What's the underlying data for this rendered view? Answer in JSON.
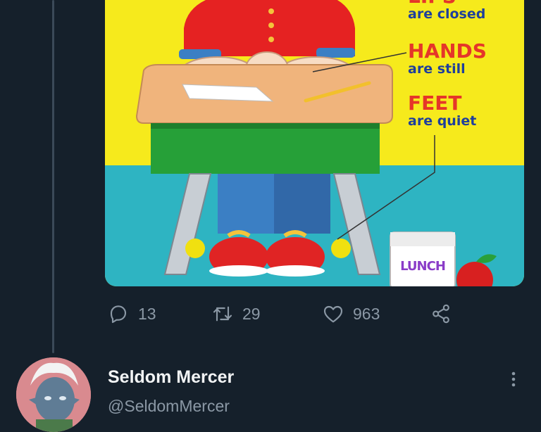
{
  "tweet": {
    "media": {
      "poster_lines": [
        {
          "title": "LIPS",
          "sub": "are closed"
        },
        {
          "title": "HANDS",
          "sub": "are still"
        },
        {
          "title": "FEET",
          "sub": "are quiet"
        }
      ],
      "bag_label": "LUNCH"
    },
    "actions": {
      "reply_count": "13",
      "retweet_count": "29",
      "like_count": "963"
    },
    "icons": [
      "reply-icon",
      "retweet-icon",
      "like-icon",
      "share-icon",
      "more-icon"
    ]
  },
  "reply": {
    "display_name": "Seldom Mercer",
    "handle": "@SeldomMercer"
  },
  "colors": {
    "background": "#15202b",
    "muted_text": "#8b98a5",
    "poster_yellow": "#f6ea1c",
    "poster_floor": "#2eb4c2",
    "poster_red_text": "#e53629",
    "poster_blue_text": "#1f3f9c"
  }
}
